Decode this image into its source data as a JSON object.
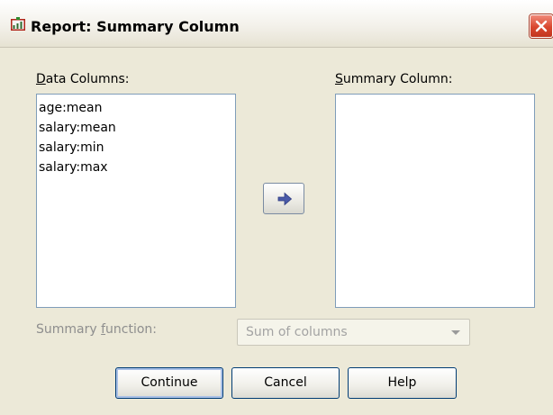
{
  "window": {
    "title": "Report: Summary Column"
  },
  "data_columns": {
    "label": "Data Columns:",
    "mnemonic": "D",
    "label_rest": "ata Columns:",
    "items": [
      "age:mean",
      "salary:mean",
      "salary:min",
      "salary:max"
    ]
  },
  "summary_column": {
    "label": "Summary Column:",
    "mnemonic": "S",
    "label_rest": "ummary Column:",
    "items": []
  },
  "move_button": {
    "icon": "arrow-right-icon"
  },
  "summary_function": {
    "label_pre": "Summary ",
    "mnemonic": "f",
    "label_rest": "unction:",
    "selected": "Sum of columns",
    "disabled": true
  },
  "buttons": {
    "continue": "Continue",
    "cancel": "Cancel",
    "help": "Help"
  },
  "colors": {
    "accent": "#4a5aa8",
    "close": "#d9472f",
    "list_border": "#7f9db9"
  }
}
